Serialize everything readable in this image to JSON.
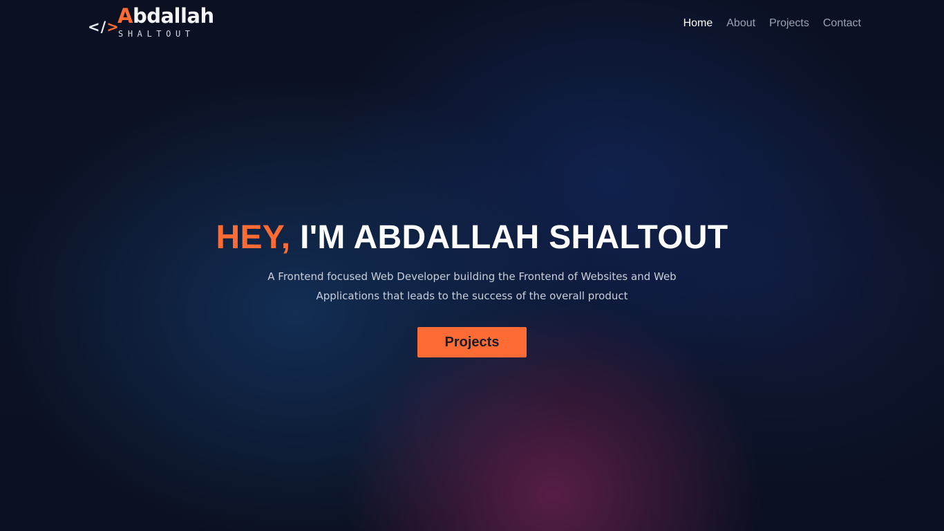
{
  "logo": {
    "code_open": "<",
    "code_slash": "/",
    "code_close": ">",
    "first_initial": "A",
    "first_rest": "bdallah",
    "last_name": "SHALTOUT"
  },
  "nav": {
    "items": [
      {
        "label": "Home",
        "active": true
      },
      {
        "label": "About",
        "active": false
      },
      {
        "label": "Projects",
        "active": false
      },
      {
        "label": "Contact",
        "active": false
      }
    ]
  },
  "hero": {
    "greeting": "HEY,",
    "title": "I'M ABDALLAH SHALTOUT",
    "description": "A Frontend focused Web Developer building the Frontend of Websites and Web Applications that leads to the success of the overall product",
    "cta_label": "Projects"
  },
  "colors": {
    "accent": "#ff6b35",
    "background": "#0b1020",
    "nav_active": "#ffffff",
    "nav_inactive": "#9aa3b4"
  }
}
